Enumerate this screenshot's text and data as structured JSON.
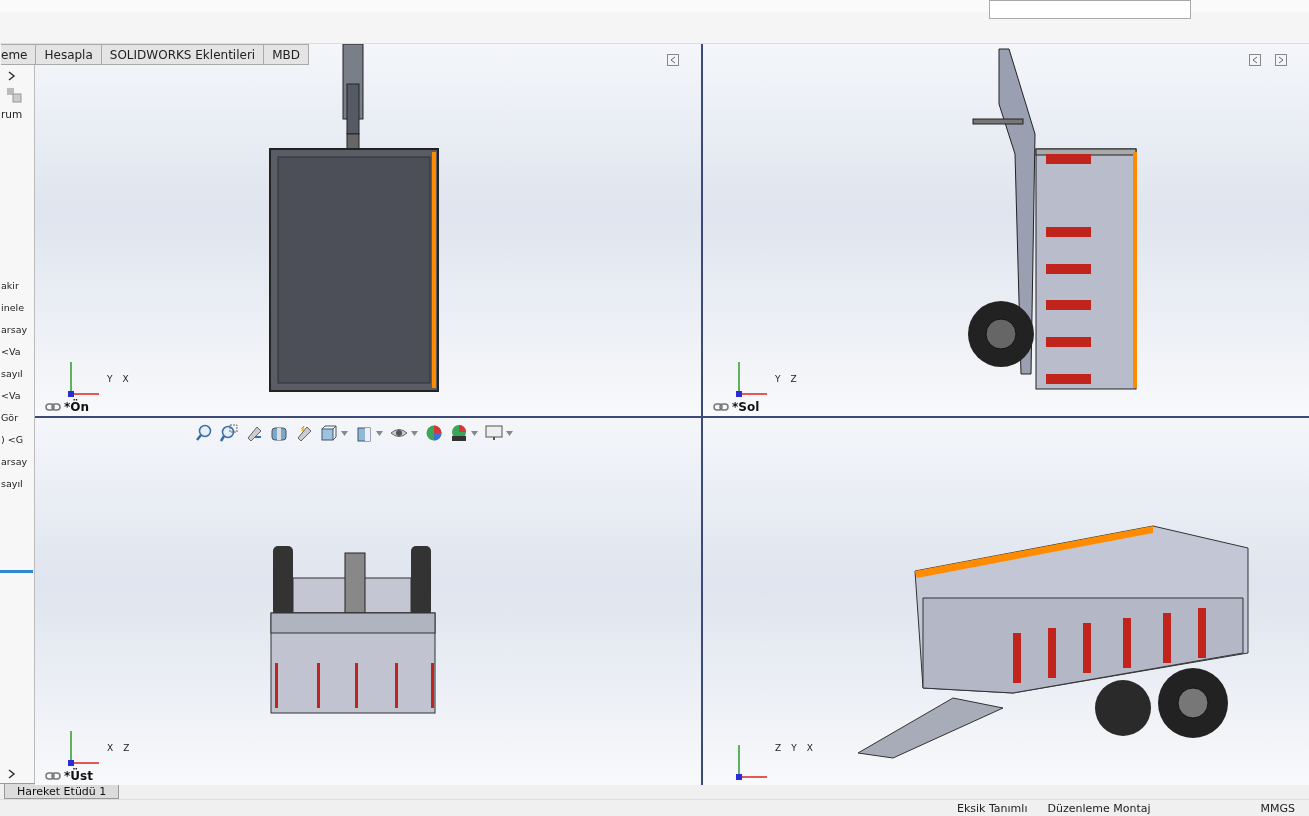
{
  "command_tabs": [
    {
      "label": "eme"
    },
    {
      "label": "Hesapla"
    },
    {
      "label": "SOLIDWORKS Eklentileri"
    },
    {
      "label": "MBD"
    }
  ],
  "feature_tree": {
    "top_items": [
      "rum"
    ],
    "items": [
      "akir",
      "inele",
      "arsay",
      "<Va",
      "sayıl",
      "<Va",
      "Gör",
      ") <G",
      "arsay",
      "sayıl"
    ]
  },
  "viewports": [
    {
      "kind": "front",
      "label": "*Ön",
      "axes": [
        "Y",
        "X"
      ]
    },
    {
      "kind": "side",
      "label": "*Sol",
      "axes": [
        "Y",
        "Z"
      ]
    },
    {
      "kind": "top",
      "label": "*Üst",
      "axes": [
        "X",
        "Z"
      ]
    },
    {
      "kind": "iso",
      "axes": [
        "Z",
        "Y",
        "X"
      ]
    }
  ],
  "study_tabs": [
    {
      "label": "Hareket Etüdü 1"
    }
  ],
  "status_bar": [
    "Eksik Tanımlı",
    "Düzenleme Montaj",
    "MMGS"
  ]
}
